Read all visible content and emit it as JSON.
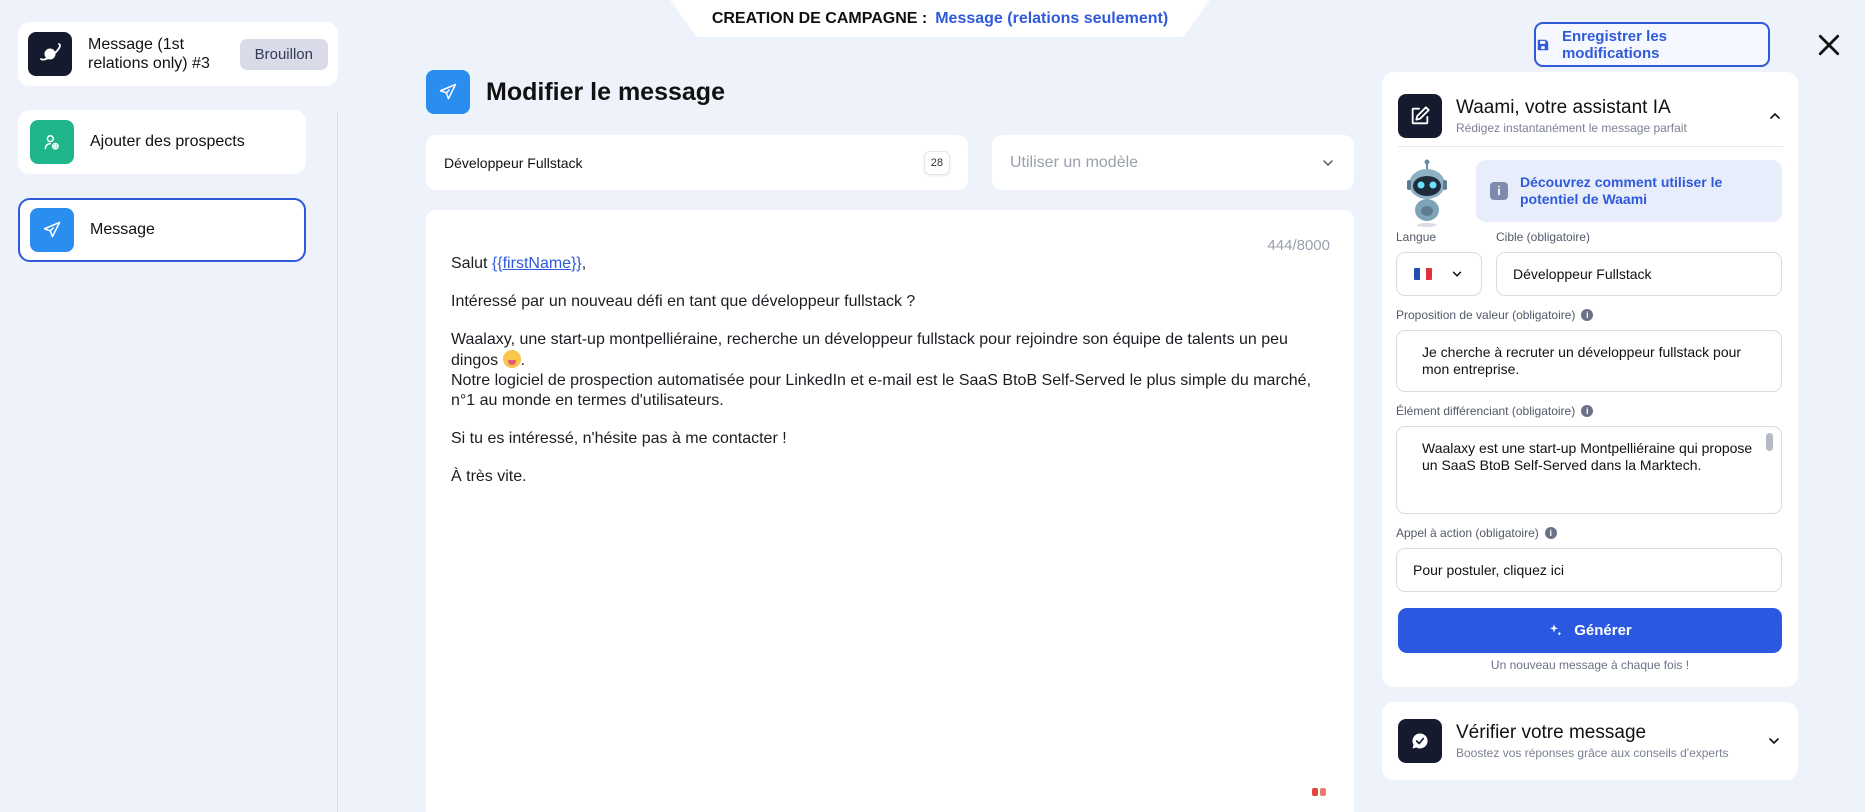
{
  "banner": {
    "label": "CREATION DE CAMPAGNE :",
    "value": "Message (relations seulement)"
  },
  "campaign": {
    "title": "Message (1st relations only) #3",
    "status": "Brouillon",
    "icon": "planet-icon"
  },
  "steps": [
    {
      "label": "Ajouter des prospects",
      "icon": "add-user-icon",
      "active": false
    },
    {
      "label": "Message",
      "icon": "send-icon",
      "active": true
    }
  ],
  "editor": {
    "title": "Modifier le message",
    "subject": "Développeur Fullstack",
    "subject_count": "28",
    "template_placeholder": "Utiliser un modèle",
    "counter": "444/8000",
    "greeting_prefix": "Salut ",
    "greeting_var": "{{firstName}}",
    "greeting_suffix": ",",
    "line1": "Intéressé par un nouveau défi en tant que développeur fullstack ?",
    "line2a": "Waalaxy, une start-up montpelliéraine, recherche un développeur fullstack pour rejoindre son équipe de talents un peu dingos",
    "line2b": ".",
    "line3": "Notre logiciel de prospection automatisée pour LinkedIn et e-mail est le SaaS BtoB Self-Served le plus simple du marché, n°1 au monde en termes d'utilisateurs.",
    "line4": "Si tu es intéressé, n'hésite pas à me contacter !",
    "line5": "À très vite."
  },
  "toolbar": {
    "save_label": "Enregistrer les modifications"
  },
  "assistant": {
    "title": "Waami, votre assistant IA",
    "subtitle": "Rédigez instantanément le message parfait",
    "info": "Découvrez comment utiliser le potentiel de Waami",
    "language_label": "Langue",
    "target_label": "Cible (obligatoire)",
    "target_value": "Développeur Fullstack",
    "value_prop_label": "Proposition de valeur (obligatoire)",
    "value_prop_value": "Je cherche à recruter un développeur fullstack pour mon entreprise.",
    "diff_label": "Élément différenciant (obligatoire)",
    "diff_value": "Waalaxy est une start-up Montpelliéraine qui propose un SaaS BtoB Self-Served dans la Marktech.",
    "cta_label": "Appel à action (obligatoire)",
    "cta_value": "Pour postuler, cliquez ici",
    "generate_label": "Générer",
    "generate_note": "Un nouveau message à chaque fois !"
  },
  "check": {
    "title": "Vérifier votre message",
    "subtitle": "Boostez vos réponses grâce aux conseils d'experts"
  },
  "colors": {
    "accent": "#2f5ad9",
    "background": "#eef2fb",
    "dark_icon": "#151a2e",
    "green_icon": "#1fb58a",
    "blue_icon": "#2a8df0"
  }
}
